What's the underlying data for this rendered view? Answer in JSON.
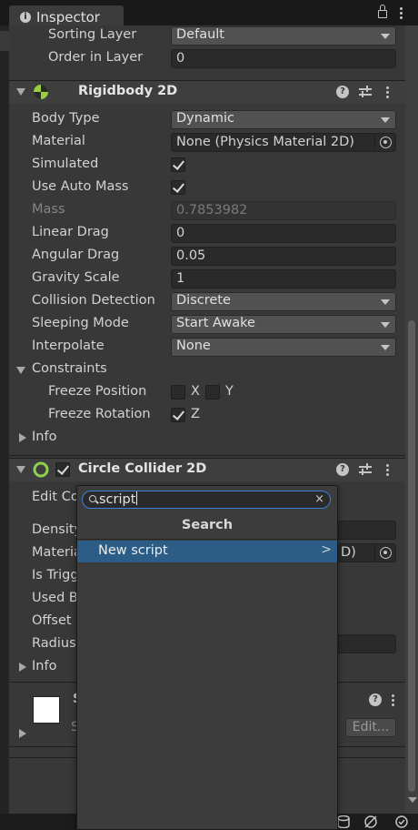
{
  "window": {
    "tab_label": "Inspector",
    "info_glyph": "i"
  },
  "sprite_renderer": {
    "sorting_layer_label": "Sorting Layer",
    "sorting_layer_value": "Default",
    "order_label": "Order in Layer",
    "order_value": "0"
  },
  "rigidbody": {
    "title": "Rigidbody 2D",
    "body_type_label": "Body Type",
    "body_type_value": "Dynamic",
    "material_label": "Material",
    "material_value": "None (Physics Material 2D)",
    "simulated_label": "Simulated",
    "simulated_checked": true,
    "auto_mass_label": "Use Auto Mass",
    "auto_mass_checked": true,
    "mass_label": "Mass",
    "mass_value": "0.7853982",
    "linear_drag_label": "Linear Drag",
    "linear_drag_value": "0",
    "angular_drag_label": "Angular Drag",
    "angular_drag_value": "0.05",
    "gravity_label": "Gravity Scale",
    "gravity_value": "1",
    "collision_label": "Collision Detection",
    "collision_value": "Discrete",
    "sleeping_label": "Sleeping Mode",
    "sleeping_value": "Start Awake",
    "interpolate_label": "Interpolate",
    "interpolate_value": "None",
    "constraints_label": "Constraints",
    "freeze_pos_label": "Freeze Position",
    "freeze_pos_x": "X",
    "freeze_pos_y": "Y",
    "freeze_rot_label": "Freeze Rotation",
    "freeze_rot_z": "Z",
    "info_label": "Info"
  },
  "circle_collider": {
    "title": "Circle Collider 2D",
    "edit_collider_label": "Edit Co",
    "density_label": "Density",
    "material_label": "Materia",
    "material_value_tail": "D)",
    "is_trigger_label": "Is Trigg",
    "used_by_label": "Used B",
    "offset_label": "Offset",
    "radius_label": "Radius",
    "info_label": "Info"
  },
  "shader_section": {
    "title_initial": "S",
    "subtitle_initial": "S",
    "edit_button": "Edit..."
  },
  "popup": {
    "search_value": "script",
    "clear_glyph": "×",
    "title": "Search",
    "item_label": "New script",
    "item_arrow": ">"
  },
  "header_icons": {
    "help_glyph": "?"
  },
  "colors": {
    "accent_blue": "#2c5d87",
    "search_focus": "#3d7fd6",
    "rigidbody_icon": "#9ccf3f",
    "collider_icon": "#8fd14f"
  }
}
